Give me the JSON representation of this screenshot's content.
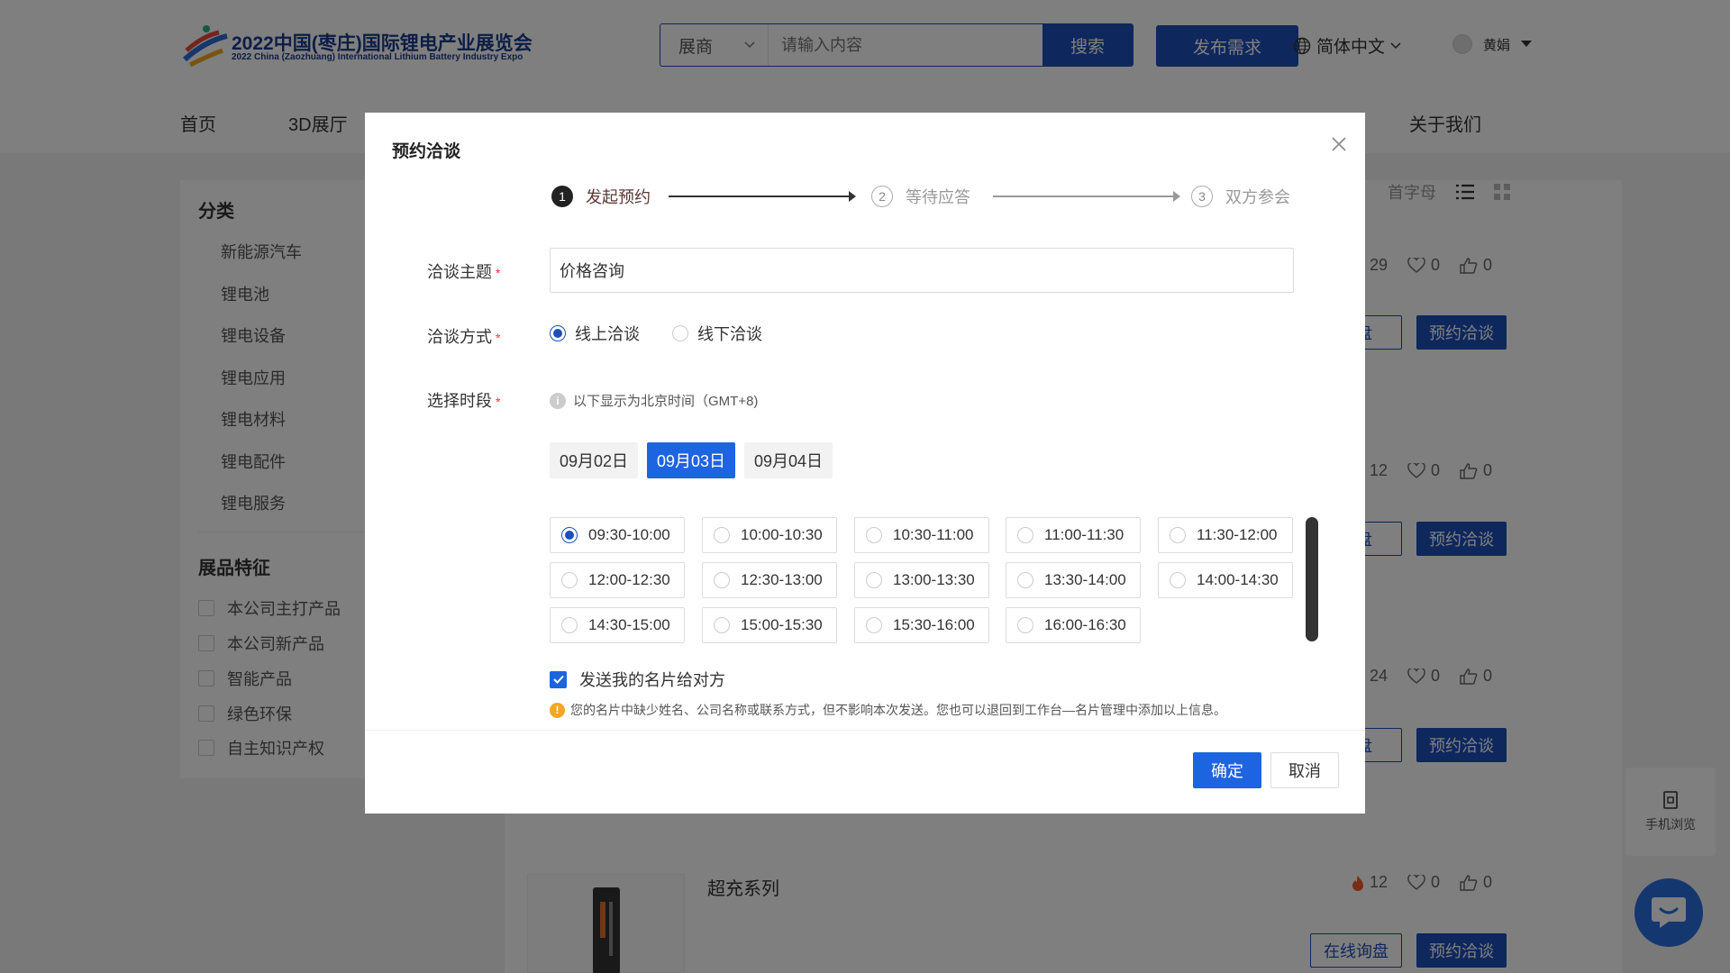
{
  "header": {
    "logo_title": "2022中国(枣庄)国际锂电产业展览会",
    "logo_subtitle": "2022 China (Zaozhuang) International Lithium Battery Industry  Expo",
    "search_type": "展商",
    "search_placeholder": "请输入内容",
    "search_button": "搜索",
    "publish_button": "发布需求",
    "language": "简体中文",
    "username": "黄娟"
  },
  "nav": [
    {
      "label": "首页"
    },
    {
      "label": "3D展厅"
    },
    {
      "label": "关于我们"
    }
  ],
  "sidebar": {
    "category_title": "分类",
    "categories": [
      "新能源汽车",
      "锂电池",
      "锂电设备",
      "锂电应用",
      "锂电材料",
      "锂电配件",
      "锂电服务"
    ],
    "feature_title": "展品特征",
    "features": [
      "本公司主打产品",
      "本公司新产品",
      "智能产品",
      "绿色环保",
      "自主知识产权"
    ]
  },
  "toolbar": {
    "sort_initial": "首字母"
  },
  "products": [
    {
      "hot": "29",
      "likes": "0",
      "thumbs": "0"
    },
    {
      "hot": "12",
      "likes": "0",
      "thumbs": "0"
    },
    {
      "hot": "24",
      "likes": "0",
      "thumbs": "0"
    },
    {
      "title": "超充系列",
      "hot": "12",
      "likes": "0",
      "thumbs": "0"
    }
  ],
  "product_buttons": {
    "inquiry": "在线询盘",
    "inquiry_partial": "询盘",
    "appointment": "预约洽谈"
  },
  "floating": {
    "mobile_view": "手机浏览"
  },
  "modal": {
    "title": "预约洽谈",
    "steps": [
      {
        "num": "1",
        "label": "发起预约"
      },
      {
        "num": "2",
        "label": "等待应答"
      },
      {
        "num": "3",
        "label": "双方参会"
      }
    ],
    "topic_label": "洽谈主题",
    "topic_value": "价格咨询",
    "method_label": "洽谈方式",
    "methods": [
      {
        "label": "线上洽谈",
        "selected": true
      },
      {
        "label": "线下洽谈",
        "selected": false
      }
    ],
    "time_label": "选择时段",
    "timezone_note": "以下显示为北京时间（GMT+8)",
    "dates": [
      {
        "label": "09月02日",
        "active": false
      },
      {
        "label": "09月03日",
        "active": true
      },
      {
        "label": "09月04日",
        "active": false
      }
    ],
    "slots": [
      {
        "label": "09:30-10:00",
        "selected": true
      },
      {
        "label": "10:00-10:30",
        "selected": false
      },
      {
        "label": "10:30-11:00",
        "selected": false
      },
      {
        "label": "11:00-11:30",
        "selected": false
      },
      {
        "label": "11:30-12:00",
        "selected": false
      },
      {
        "label": "12:00-12:30",
        "selected": false
      },
      {
        "label": "12:30-13:00",
        "selected": false
      },
      {
        "label": "13:00-13:30",
        "selected": false
      },
      {
        "label": "13:30-14:00",
        "selected": false
      },
      {
        "label": "14:00-14:30",
        "selected": false
      },
      {
        "label": "14:30-15:00",
        "selected": false
      },
      {
        "label": "15:00-15:30",
        "selected": false
      },
      {
        "label": "15:30-16:00",
        "selected": false
      },
      {
        "label": "16:00-16:30",
        "selected": false
      }
    ],
    "send_card_label": "发送我的名片给对方",
    "send_card_checked": true,
    "warning_note": "您的名片中缺少姓名、公司名称或联系方式，但不影响本次发送。您也可以退回到工作台—名片管理中添加以上信息。",
    "ok_button": "确定",
    "cancel_button": "取消"
  },
  "colors": {
    "primary": "#1d4fb8",
    "accent": "#1d64e0",
    "required": "#e33333",
    "warning": "#f5a623",
    "hot": "#f05a28"
  }
}
